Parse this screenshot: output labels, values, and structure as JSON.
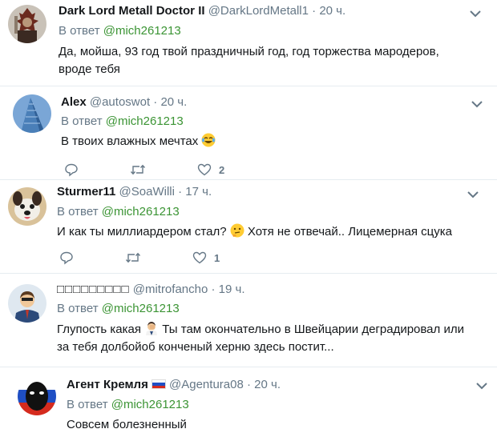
{
  "tweets": [
    {
      "name": "Dark Lord Metall Doctor II",
      "handle": "@DarkLordMetall1",
      "time": "· 20 ч.",
      "reply_prefix": "В ответ ",
      "reply_to": "@mich261213",
      "text": "Да, мойша, 93 год твой праздничный год, год торжества мародеров, вроде тебя",
      "avatar_icon": "warrior-avatar"
    },
    {
      "name": "Alex",
      "handle": "@autoswot",
      "time": "· 20 ч.",
      "reply_prefix": "В ответ ",
      "reply_to": "@mich261213",
      "text": "В твоих влажных мечтах",
      "emoji": "laughing-tears-emoji",
      "like_count": "2",
      "avatar_icon": "skyscraper-avatar"
    },
    {
      "name": "Sturmer11",
      "handle": "@SoaWilli",
      "time": "· 17 ч.",
      "reply_prefix": "В ответ ",
      "reply_to": "@mich261213",
      "text_before": "И как ты миллиардером стал?",
      "text_after": "Хотя не отвечай.. Лицемерная сцука",
      "emoji": "thinking-face-emoji",
      "like_count": "1",
      "avatar_icon": "dog-avatar"
    },
    {
      "name": "□□□□□□□□□",
      "handle": "@mitrofancho",
      "time": "· 19 ч.",
      "reply_prefix": "В ответ ",
      "reply_to": "@mich261213",
      "text_before": "Глупость какая",
      "text_after": "Ты там окончательно в Швейцарии деградировал или за тебя долбойоб конченый херню здесь постит...",
      "emoji": "facepalm-emoji",
      "avatar_icon": "businessman-avatar"
    },
    {
      "name": "Агент Кремля",
      "handle": "@Agentura08",
      "time": "· 20 ч.",
      "reply_prefix": "В ответ ",
      "reply_to": "@mich261213",
      "text": "Совсем болезненный",
      "flag_icon": "russia-flag-icon",
      "avatar_icon": "mask-avatar"
    }
  ],
  "colors": {
    "muted": "#657786",
    "reply_link": "#3b9434",
    "divider": "#e6ecf0"
  }
}
